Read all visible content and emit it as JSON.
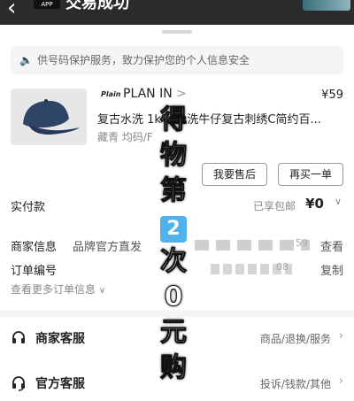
{
  "header": {
    "title": "交易成功",
    "logo_text": "APP"
  },
  "notice": {
    "text": "供号码保护服务，致力保护您的个人信息安全"
  },
  "product": {
    "shop_logo": "Plain",
    "shop_name": "PLAN IN",
    "shop_chevron": ">",
    "price": "¥59",
    "name": "复古水洗 1k% 水洗牛仔复古刺绣C简约百...",
    "spec": "藏青  均码/F",
    "btn_after_sale": "我要售后",
    "btn_rebuy": "再买一单"
  },
  "payment": {
    "label": "实付款",
    "shipping": "已享包邮",
    "amount": "¥0"
  },
  "merchant_info": {
    "label": "商家信息",
    "value": "品牌官方直发",
    "tail": "59",
    "action": "查看"
  },
  "order_no": {
    "label": "订单编号",
    "tail": "08",
    "action": "复制"
  },
  "more_orders": "查看更多订单信息",
  "services": [
    {
      "label": "商家客服",
      "sub": "商品/退换/服务"
    },
    {
      "label": "官方客服",
      "sub": "投诉/钱款/其他"
    }
  ],
  "overlay": {
    "chars": [
      "得",
      "物",
      "第",
      "2",
      "次",
      "0",
      "元",
      "购"
    ]
  }
}
